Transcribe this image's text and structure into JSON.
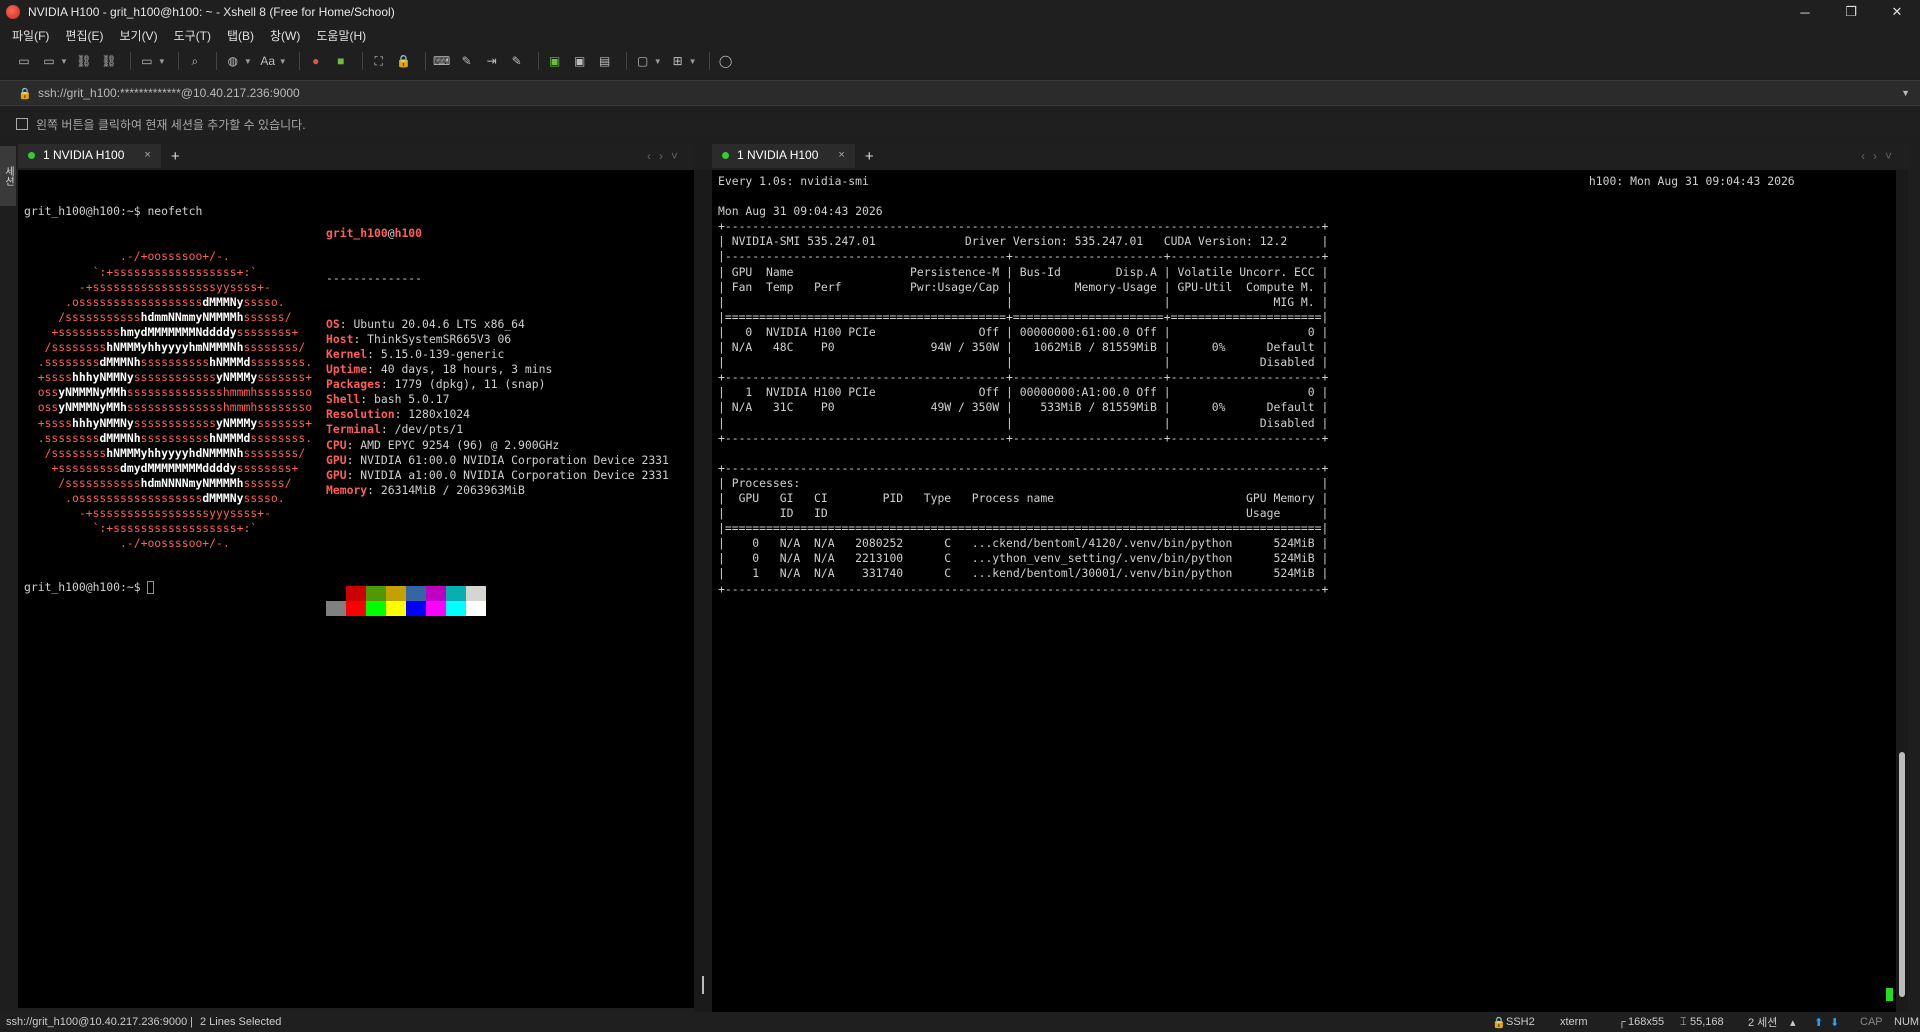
{
  "window": {
    "title": "NVIDIA H100 - grit_h100@h100: ~ - Xshell 8 (Free for Home/School)",
    "controls": [
      "─",
      "❐",
      "✕"
    ]
  },
  "menu": [
    "파일(F)",
    "편집(E)",
    "보기(V)",
    "도구(T)",
    "탭(B)",
    "창(W)",
    "도움말(H)"
  ],
  "address": {
    "url": "ssh://grit_h100:*************@10.40.217.236:9000"
  },
  "hint": "왼쪽 버튼을 클릭하여 현재 세션을 추가할 수 있습니다.",
  "sidetab": "세션",
  "left_tab": {
    "label": "1 NVIDIA H100",
    "close": "×",
    "add": "+"
  },
  "right_tab": {
    "label": "1 NVIDIA H100",
    "close": "×",
    "add": "+"
  },
  "left_term": {
    "cmd_line": "grit_h100@h100:~$ neofetch",
    "logo": [
      "              .-/+oossssoo+/-.",
      "          `:+ssssssssssssssssss+:`",
      "        -+ssssssssssssssssssyyssss+-",
      "      .ossssssssssssssssssdMMMNysssso.",
      "     /ssssssssssshdmmNNmmyNMMMMhssssss/",
      "    +ssssssssshmydMMMMMMMNddddyssssssss+",
      "   /sssssssshNMMMyhhyyyyhmNMMMNhssssssss/",
      "  .ssssssssdMMMNhsssssssssshNMMMdssssssss.",
      "  +sssshhhyNMMNyssssssssssssyNMMMysssssss+",
      "  ossyNMMMNyMMhsssssssssssssshmmmhssssssso",
      "  ossyNMMMNyMMhsssssssssssssshmmmhssssssso",
      "  +sssshhhyNMMNyssssssssssssyNMMMysssssss+",
      "  .ssssssssdMMMNhsssssssssshNMMMdssssssss.",
      "   /sssssssshNMMMyhhyyyyhdNMMMNhssssssss/",
      "    +sssssssssdmydMMMMMMMMddddyssssssss+",
      "     /ssssssssssshdmNNNNmyNMMMMhssssss/",
      "      .ossssssssssssssssssdMMMNysssso.",
      "        -+sssssssssssssssssyyyssss+-",
      "          `:+ssssssssssssssssss+:`",
      "              .-/+oossssoo+/-."
    ],
    "user": "grit_h100",
    "at": "@",
    "host": "h100",
    "separator": "--------------",
    "info": [
      {
        "key": "OS",
        "value": "Ubuntu 20.04.6 LTS x86_64"
      },
      {
        "key": "Host",
        "value": "ThinkSystemSR665V3 06"
      },
      {
        "key": "Kernel",
        "value": "5.15.0-139-generic"
      },
      {
        "key": "Uptime",
        "value": "40 days, 18 hours, 3 mins"
      },
      {
        "key": "Packages",
        "value": "1779 (dpkg), 11 (snap)"
      },
      {
        "key": "Shell",
        "value": "bash 5.0.17"
      },
      {
        "key": "Resolution",
        "value": "1280x1024"
      },
      {
        "key": "Terminal",
        "value": "/dev/pts/1"
      },
      {
        "key": "CPU",
        "value": "AMD EPYC 9254 (96) @ 2.900GHz"
      },
      {
        "key": "GPU",
        "value": "NVIDIA 61:00.0 NVIDIA Corporation Device 2331"
      },
      {
        "key": "GPU",
        "value": "NVIDIA a1:00.0 NVIDIA Corporation Device 2331"
      },
      {
        "key": "Memory",
        "value": "26314MiB / 2063963MiB"
      }
    ],
    "palette_top": [
      "#000000",
      "#cc0000",
      "#4e9a06",
      "#c4a000",
      "#3465a4",
      "#c000c0",
      "#06b0b0",
      "#d3d7cf"
    ],
    "palette_bottom": [
      "#808080",
      "#ff0000",
      "#00ff00",
      "#ffff00",
      "#0000ff",
      "#ff00ff",
      "#00ffff",
      "#ffffff"
    ],
    "prompt": "grit_h100@h100:~$ "
  },
  "right_term": {
    "lines": [
      "Every 1.0s: nvidia-smi                                                                                                         h100: Mon Aug 31 09:04:43 2026",
      "",
      "Mon Aug 31 09:04:43 2026",
      "+---------------------------------------------------------------------------------------+",
      "| NVIDIA-SMI 535.247.01             Driver Version: 535.247.01   CUDA Version: 12.2     |",
      "|-----------------------------------------+----------------------+----------------------+",
      "| GPU  Name                 Persistence-M | Bus-Id        Disp.A | Volatile Uncorr. ECC |",
      "| Fan  Temp   Perf          Pwr:Usage/Cap |         Memory-Usage | GPU-Util  Compute M. |",
      "|                                         |                      |               MIG M. |",
      "|=========================================+======================+======================|",
      "|   0  NVIDIA H100 PCIe               Off | 00000000:61:00.0 Off |                    0 |",
      "| N/A   48C    P0              94W / 350W |   1062MiB / 81559MiB |      0%      Default |",
      "|                                         |                      |             Disabled |",
      "+-----------------------------------------+----------------------+----------------------+",
      "|   1  NVIDIA H100 PCIe               Off | 00000000:A1:00.0 Off |                    0 |",
      "| N/A   31C    P0              49W / 350W |    533MiB / 81559MiB |      0%      Default |",
      "|                                         |                      |             Disabled |",
      "+-----------------------------------------+----------------------+----------------------+",
      "",
      "+---------------------------------------------------------------------------------------+",
      "| Processes:                                                                            |",
      "|  GPU   GI   CI        PID   Type   Process name                            GPU Memory |",
      "|        ID   ID                                                             Usage      |",
      "|=======================================================================================|",
      "|    0   N/A  N/A   2080252      C   ...ckend/bentoml/4120/.venv/bin/python      524MiB |",
      "|    0   N/A  N/A   2213100      C   ...ython_venv_setting/.venv/bin/python      524MiB |",
      "|    1   N/A  N/A    331740      C   ...kend/bentoml/30001/.venv/bin/python      524MiB |",
      "+---------------------------------------------------------------------------------------+"
    ]
  },
  "status": {
    "connection": "ssh://grit_h100@10.40.217.236:9000",
    "selection": "2 Lines Selected",
    "protocol": "SSH2",
    "term_type": "xterm",
    "size": "168x55",
    "cursor_pos": "55,168",
    "sessions": "2 세션",
    "cap": "CAP",
    "num": "NUM"
  }
}
